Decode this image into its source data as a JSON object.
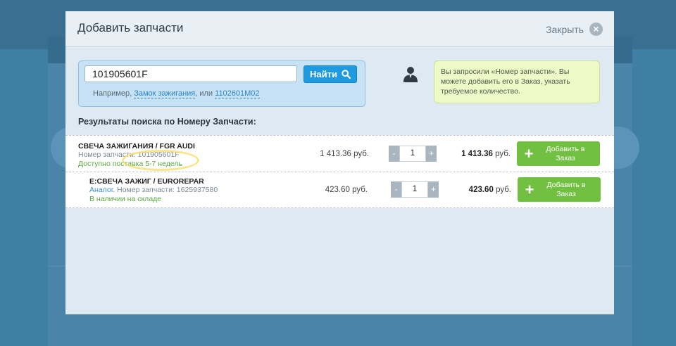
{
  "modal": {
    "title": "Добавить запчасти",
    "close_label": "Закрыть"
  },
  "search": {
    "value": "101905601F",
    "button_label": "Найти",
    "example_prefix": "Например,",
    "example_link1": "Замок зажигания",
    "example_middle": ", или",
    "example_link2": "1102601M02"
  },
  "tip": {
    "text": "Вы запросили «Номер запчасти». Вы можете добавить его в Заказ, указать требуемое количество."
  },
  "results": {
    "title": "Результаты поиска по Номеру Запчасти:",
    "items": [
      {
        "name": "СВЕЧА ЗАЖИГАНИЯ / FGR AUDI",
        "part_label": "Номер запчасти: 101905601F",
        "availability": "Доступно поставка 5-7 недель",
        "price": "1 413.36 руб.",
        "qty": "1",
        "total_value": "1 413.36",
        "total_unit": "руб.",
        "add_label": "Добавить в Заказ"
      },
      {
        "name": "E:СВЕЧА ЗАЖИГ / Eurorepar",
        "analog_label": "Аналог.",
        "part_label": "Номер запчасти: 1625937580",
        "availability": "В наличии на складе",
        "price": "423.60 руб.",
        "qty": "1",
        "total_value": "423.60",
        "total_unit": "руб.",
        "add_label": "Добавить в Заказ"
      }
    ]
  },
  "stepper": {
    "minus": "-",
    "plus": "+"
  },
  "icons": {
    "close": "close-icon",
    "search": "search-icon",
    "person": "person-icon",
    "add": "plus-icon"
  },
  "colors": {
    "accent": "#1e9be0",
    "add_button": "#72c042",
    "availability": "#5aa840"
  }
}
